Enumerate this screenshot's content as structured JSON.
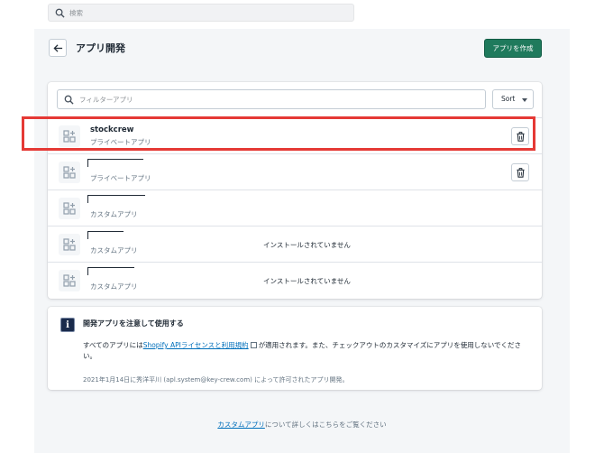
{
  "topbar": {
    "search_placeholder": "検索"
  },
  "header": {
    "title": "アプリ開発",
    "create_button": "アプリを作成"
  },
  "filter": {
    "placeholder": "フィルターアプリ",
    "sort_label": "Sort"
  },
  "apps": [
    {
      "name": "stockcrew",
      "type": "プライベートアプリ",
      "status": "",
      "deletable": true
    },
    {
      "name": "",
      "type": "プライベートアプリ",
      "status": "",
      "deletable": true
    },
    {
      "name": "",
      "type": "カスタムアプリ",
      "status": "",
      "deletable": false
    },
    {
      "name": "",
      "type": "カスタムアプリ",
      "status": "インストールされていません",
      "deletable": false
    },
    {
      "name": "",
      "type": "カスタムアプリ",
      "status": "インストールされていません",
      "deletable": false
    }
  ],
  "info": {
    "title": "開発アプリを注意して使用する",
    "body_prefix": "すべてのアプリには",
    "license_link": "Shopify APIライセンスと利用規約",
    "body_suffix": "が適用されます。また、チェックアウトのカスタマイズにアプリを使用しないでください。",
    "footer": "2021年1月14日に秀洋平川 (apl.system@key-crew.com) によって許可されたアプリ開発。"
  },
  "bottom": {
    "link": "カスタムアプリ",
    "suffix": "について詳しくはこちらをご覧ください"
  },
  "colors": {
    "primary": "#1f7a5c",
    "highlight": "#e53935",
    "link": "#006fbb"
  }
}
